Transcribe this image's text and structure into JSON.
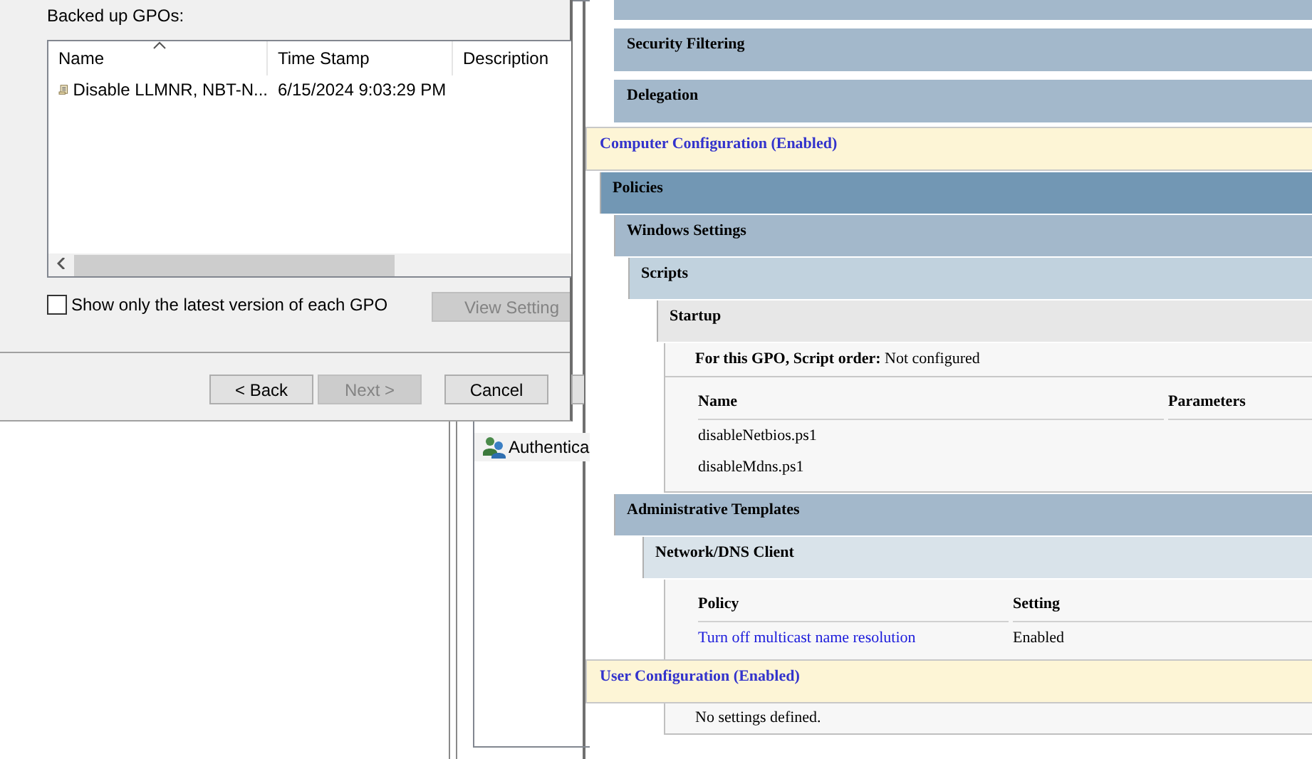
{
  "dialog": {
    "list_label": "Backed up GPOs:",
    "columns": [
      {
        "label": "Name",
        "sorted": true
      },
      {
        "label": "Time Stamp",
        "sorted": false
      },
      {
        "label": "Description",
        "sorted": false
      }
    ],
    "rows": [
      {
        "name": "Disable LLMNR, NBT-N...",
        "time_stamp": "6/15/2024 9:03:29 PM"
      }
    ],
    "checkbox": {
      "label": "Show only the latest version of each GPO",
      "checked": false
    },
    "view_button": {
      "label": "View Setting",
      "disabled": true
    },
    "buttons": [
      {
        "label": "< Back",
        "disabled": false
      },
      {
        "label": "Next >",
        "disabled": true
      },
      {
        "label": "Cancel",
        "disabled": false
      }
    ]
  },
  "background_window": {
    "items": [
      {
        "label": "Authentica"
      }
    ]
  },
  "report": {
    "gpo_sections": [
      {
        "kind": "cut"
      },
      {
        "kind": "heading",
        "title": "Security Filtering"
      },
      {
        "kind": "heading",
        "title": "Delegation"
      }
    ],
    "configurations": [
      {
        "title": "Computer Configuration (Enabled)",
        "children": [
          {
            "title": "Policies",
            "children": [
              {
                "title": "Windows Settings",
                "children": [
                  {
                    "title": "Scripts",
                    "children": [
                      {
                        "title": "Startup",
                        "content": {
                          "kind": "scripts",
                          "order_label": "For this GPO, Script order:",
                          "order_value": "Not configured",
                          "columns": [
                            "Name",
                            "Parameters"
                          ],
                          "rows": [
                            {
                              "name": "disableNetbios.ps1"
                            },
                            {
                              "name": "disableMdns.ps1"
                            }
                          ]
                        }
                      }
                    ]
                  }
                ]
              },
              {
                "title": "Administrative Templates",
                "children": [
                  {
                    "title": "Network/DNS Client",
                    "content": {
                      "kind": "policies",
                      "columns": [
                        "Policy",
                        "Setting"
                      ],
                      "rows": [
                        {
                          "policy": "Turn off multicast name resolution",
                          "setting": "Enabled"
                        }
                      ]
                    }
                  }
                ]
              }
            ]
          }
        ]
      },
      {
        "title": "User Configuration (Enabled)",
        "note": "No settings defined."
      }
    ]
  }
}
